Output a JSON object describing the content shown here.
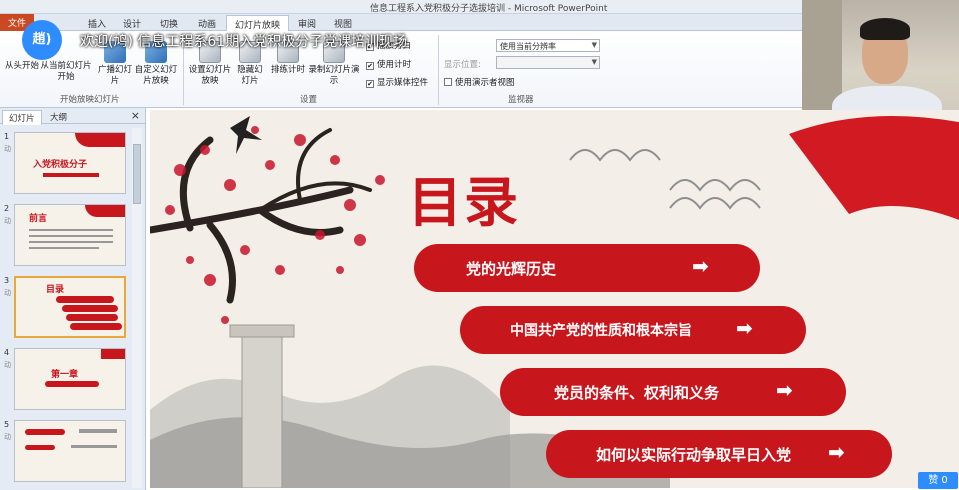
{
  "window": {
    "title": "信息工程系入党积极分子选拔培训 - Microsoft PowerPoint"
  },
  "ribbon_tabs": [
    "文件",
    "插入",
    "设计",
    "切换",
    "动画",
    "幻灯片放映",
    "审阅",
    "视图"
  ],
  "ribbon": {
    "buttons": {
      "from_start": "从头开始",
      "from_current": "从当前幻灯片开始",
      "broadcast": "广播幻灯片",
      "custom": "自定义幻灯片放映",
      "setup": "设置幻灯片放映",
      "hide": "隐藏幻灯片",
      "rehearse": "排练计时",
      "record": "录制幻灯片演示"
    },
    "groups": {
      "start_show": "开始放映幻灯片",
      "setup": "设置",
      "monitors": "监视器"
    },
    "checks": {
      "play_narrations": "播放旁白",
      "use_timings": "使用计时",
      "show_media_controls": "显示媒体控件",
      "presenter_view": "使用演示者视图"
    },
    "resolution_value": "使用当前分辨率",
    "show_on_label": "显示位置:"
  },
  "live_overlay": {
    "avatar_text": "趙)",
    "welcome_text": "欢迎(鸠)  信息工程系61期入党积极分子党课培训现场"
  },
  "pane": {
    "tabs": [
      "幻灯片",
      "大纲"
    ],
    "close_glyph": "×",
    "slides": [
      {
        "num": "1",
        "sub": "动",
        "title": "入党积极分子"
      },
      {
        "num": "2",
        "sub": "动",
        "title": "前言"
      },
      {
        "num": "3",
        "sub": "动",
        "title": "目录"
      },
      {
        "num": "4",
        "sub": "动",
        "title": "第一章"
      },
      {
        "num": "5",
        "sub": "动",
        "title": ""
      }
    ]
  },
  "slide": {
    "title": "目录",
    "items": [
      {
        "text": "党的光辉历史",
        "arrow": "➡"
      },
      {
        "text": "中国共产党的性质和根本宗旨",
        "arrow": "➡"
      },
      {
        "text": "党员的条件、权利和义务",
        "arrow": "➡"
      },
      {
        "text": "如何以实际行动争取早日入党",
        "arrow": "➡"
      }
    ],
    "accent_color": "#c8161d"
  },
  "likes_text": "赞 0"
}
